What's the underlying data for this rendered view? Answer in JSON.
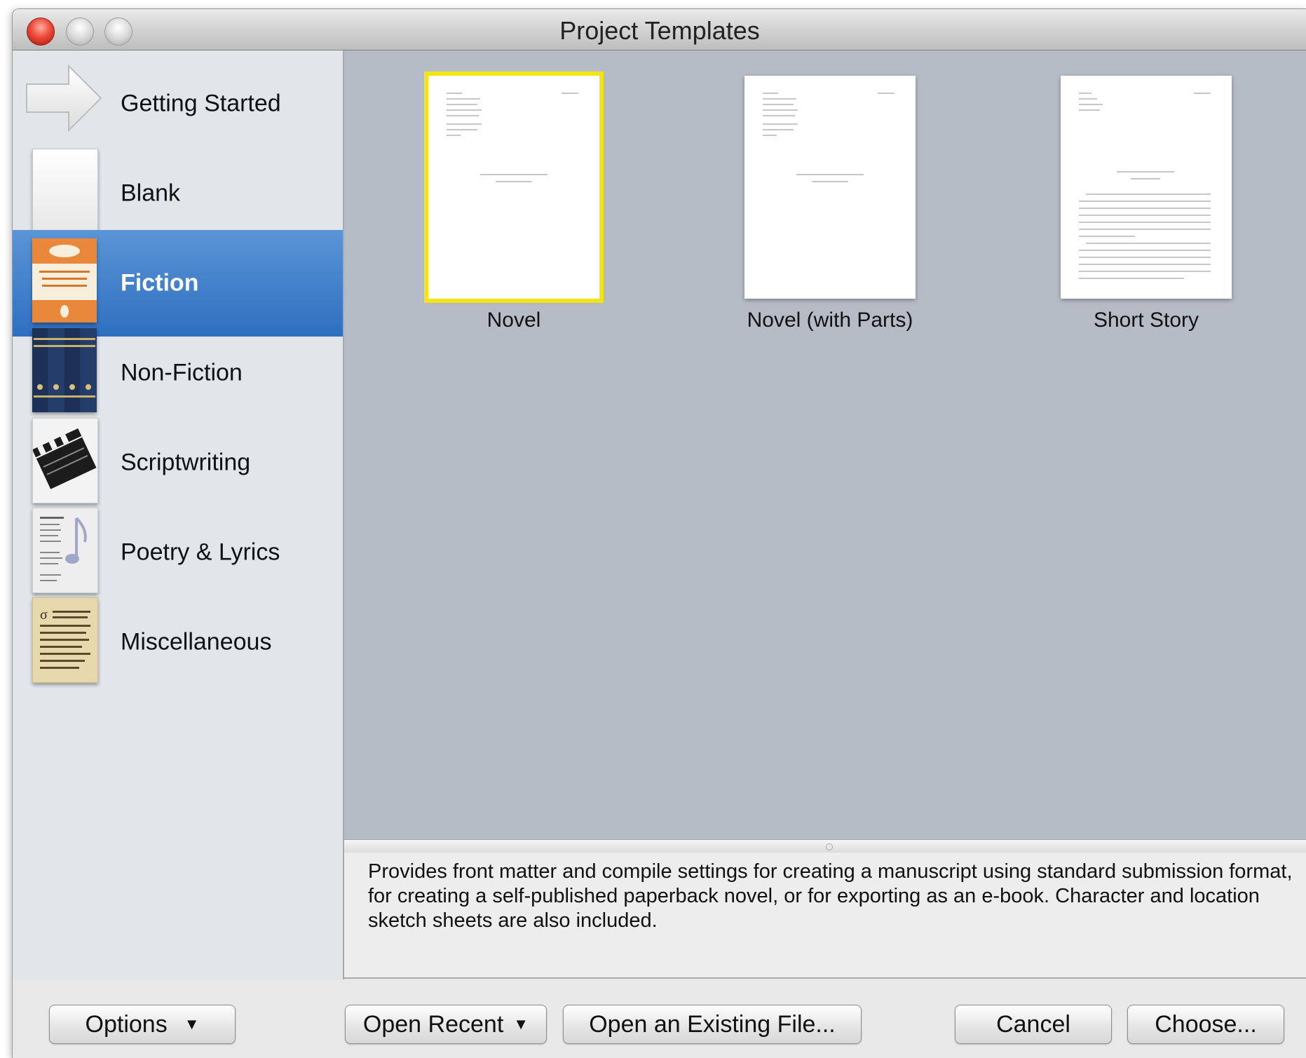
{
  "window": {
    "title": "Project Templates"
  },
  "sidebar": {
    "items": [
      {
        "label": "Getting Started",
        "icon": "arrow-icon",
        "selected": false
      },
      {
        "label": "Blank",
        "icon": "blank-page-icon",
        "selected": false
      },
      {
        "label": "Fiction",
        "icon": "book-cover-icon",
        "selected": true
      },
      {
        "label": "Non-Fiction",
        "icon": "book-spines-icon",
        "selected": false
      },
      {
        "label": "Scriptwriting",
        "icon": "clapperboard-icon",
        "selected": false
      },
      {
        "label": "Poetry & Lyrics",
        "icon": "music-note-icon",
        "selected": false
      },
      {
        "label": "Miscellaneous",
        "icon": "parchment-icon",
        "selected": false
      }
    ]
  },
  "templates": [
    {
      "label": "Novel",
      "selected": true
    },
    {
      "label": "Novel (with Parts)",
      "selected": false
    },
    {
      "label": "Short Story",
      "selected": false
    }
  ],
  "description": "Provides front matter and compile settings for creating a manuscript using standard submission format, for creating a self-published paperback novel, or for exporting as an e-book. Character and location sketch sheets are also included.",
  "buttons": {
    "options": "Options",
    "open_recent": "Open Recent",
    "open_existing": "Open an Existing File...",
    "cancel": "Cancel",
    "choose": "Choose..."
  },
  "colors": {
    "selection_blue": "#2e6fc0",
    "template_highlight": "#f4e414",
    "close_button": "#ee4a3a"
  }
}
